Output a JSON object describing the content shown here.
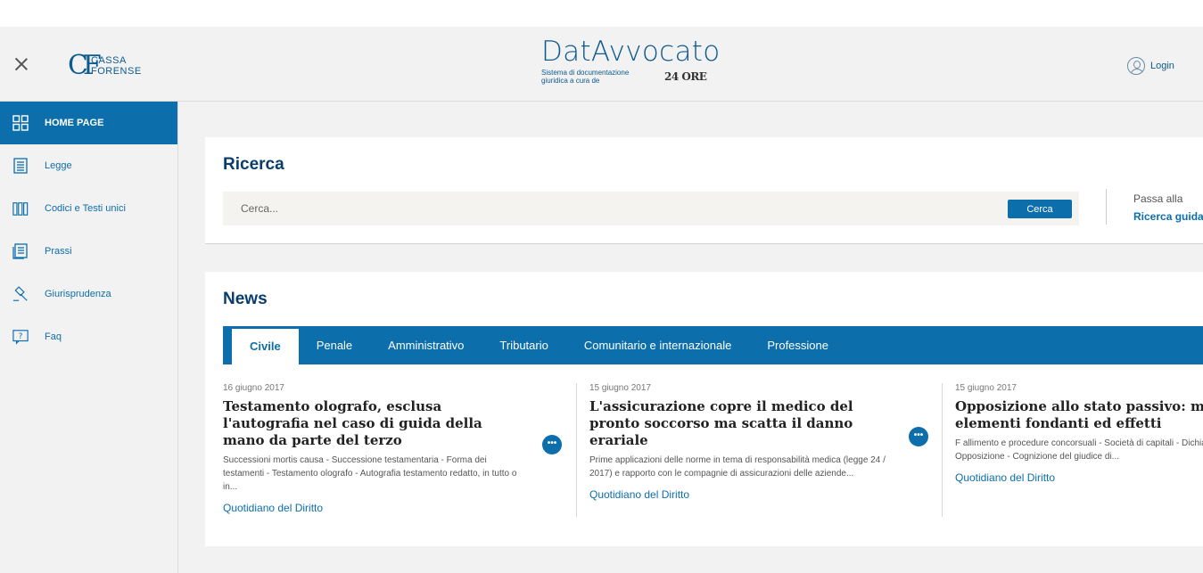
{
  "header": {
    "logo_letters": "CF",
    "logo_line1": "CASSA",
    "logo_line2": "FORENSE",
    "brand_title": "DatAvvocato",
    "brand_desc": "Sistema di documentazione giuridica a cura de",
    "brand_publisher": "24 ORE",
    "login_label": "Login"
  },
  "sidebar": {
    "items": [
      {
        "label": "HOME PAGE",
        "icon": "grid-icon",
        "active": true
      },
      {
        "label": "Legge",
        "icon": "document-icon"
      },
      {
        "label": "Codici e Testi unici",
        "icon": "books-icon"
      },
      {
        "label": "Prassi",
        "icon": "pages-icon"
      },
      {
        "label": "Giurisprudenza",
        "icon": "gavel-icon"
      },
      {
        "label": "Faq",
        "icon": "question-icon"
      }
    ]
  },
  "search": {
    "title": "Ricerca",
    "placeholder": "Cerca...",
    "button_label": "Cerca",
    "passa_label": "Passa alla",
    "guided_link": "Ricerca guidata"
  },
  "news": {
    "title": "News",
    "tabs": [
      "Civile",
      "Penale",
      "Amministrativo",
      "Tributario",
      "Comunitario e internazionale",
      "Professione"
    ],
    "active_tab": "Civile",
    "articles": [
      {
        "date": "16 giugno 2017",
        "title": "Testamento olografo, esclusa l'autografia nel caso di guida della mano da parte del terzo",
        "abstract": "Successioni mortis causa - Successione testamentaria - Forma dei testamenti - Testamento olografo - Autografia testamento redatto, in tutto o in...",
        "source": "Quotidiano del Diritto",
        "more": "•••"
      },
      {
        "date": "15 giugno 2017",
        "title": "L'assicurazione copre il medico del pronto soccorso ma scatta il danno erariale",
        "abstract": "Prime applicazioni delle norme in tema di responsabilità medica (legge 24 / 2017) e rapporto con le compagnie di assicurazioni delle aziende...",
        "source": "Quotidiano del Diritto",
        "more": "•••"
      },
      {
        "date": "15 giugno 2017",
        "title": "Opposizione allo stato passivo: modi, termini, elementi fondanti ed effetti",
        "abstract": "F allimento e procedure concorsuali - Società di capitali - Dichiarazione di fallimento - Opposizione - Cognizione del giudice di...",
        "source": "Quotidiano del Diritto"
      }
    ]
  },
  "colors": {
    "primary": "#0d6eac",
    "title_dark": "#0a3d6b",
    "background": "#f2f2f2"
  }
}
